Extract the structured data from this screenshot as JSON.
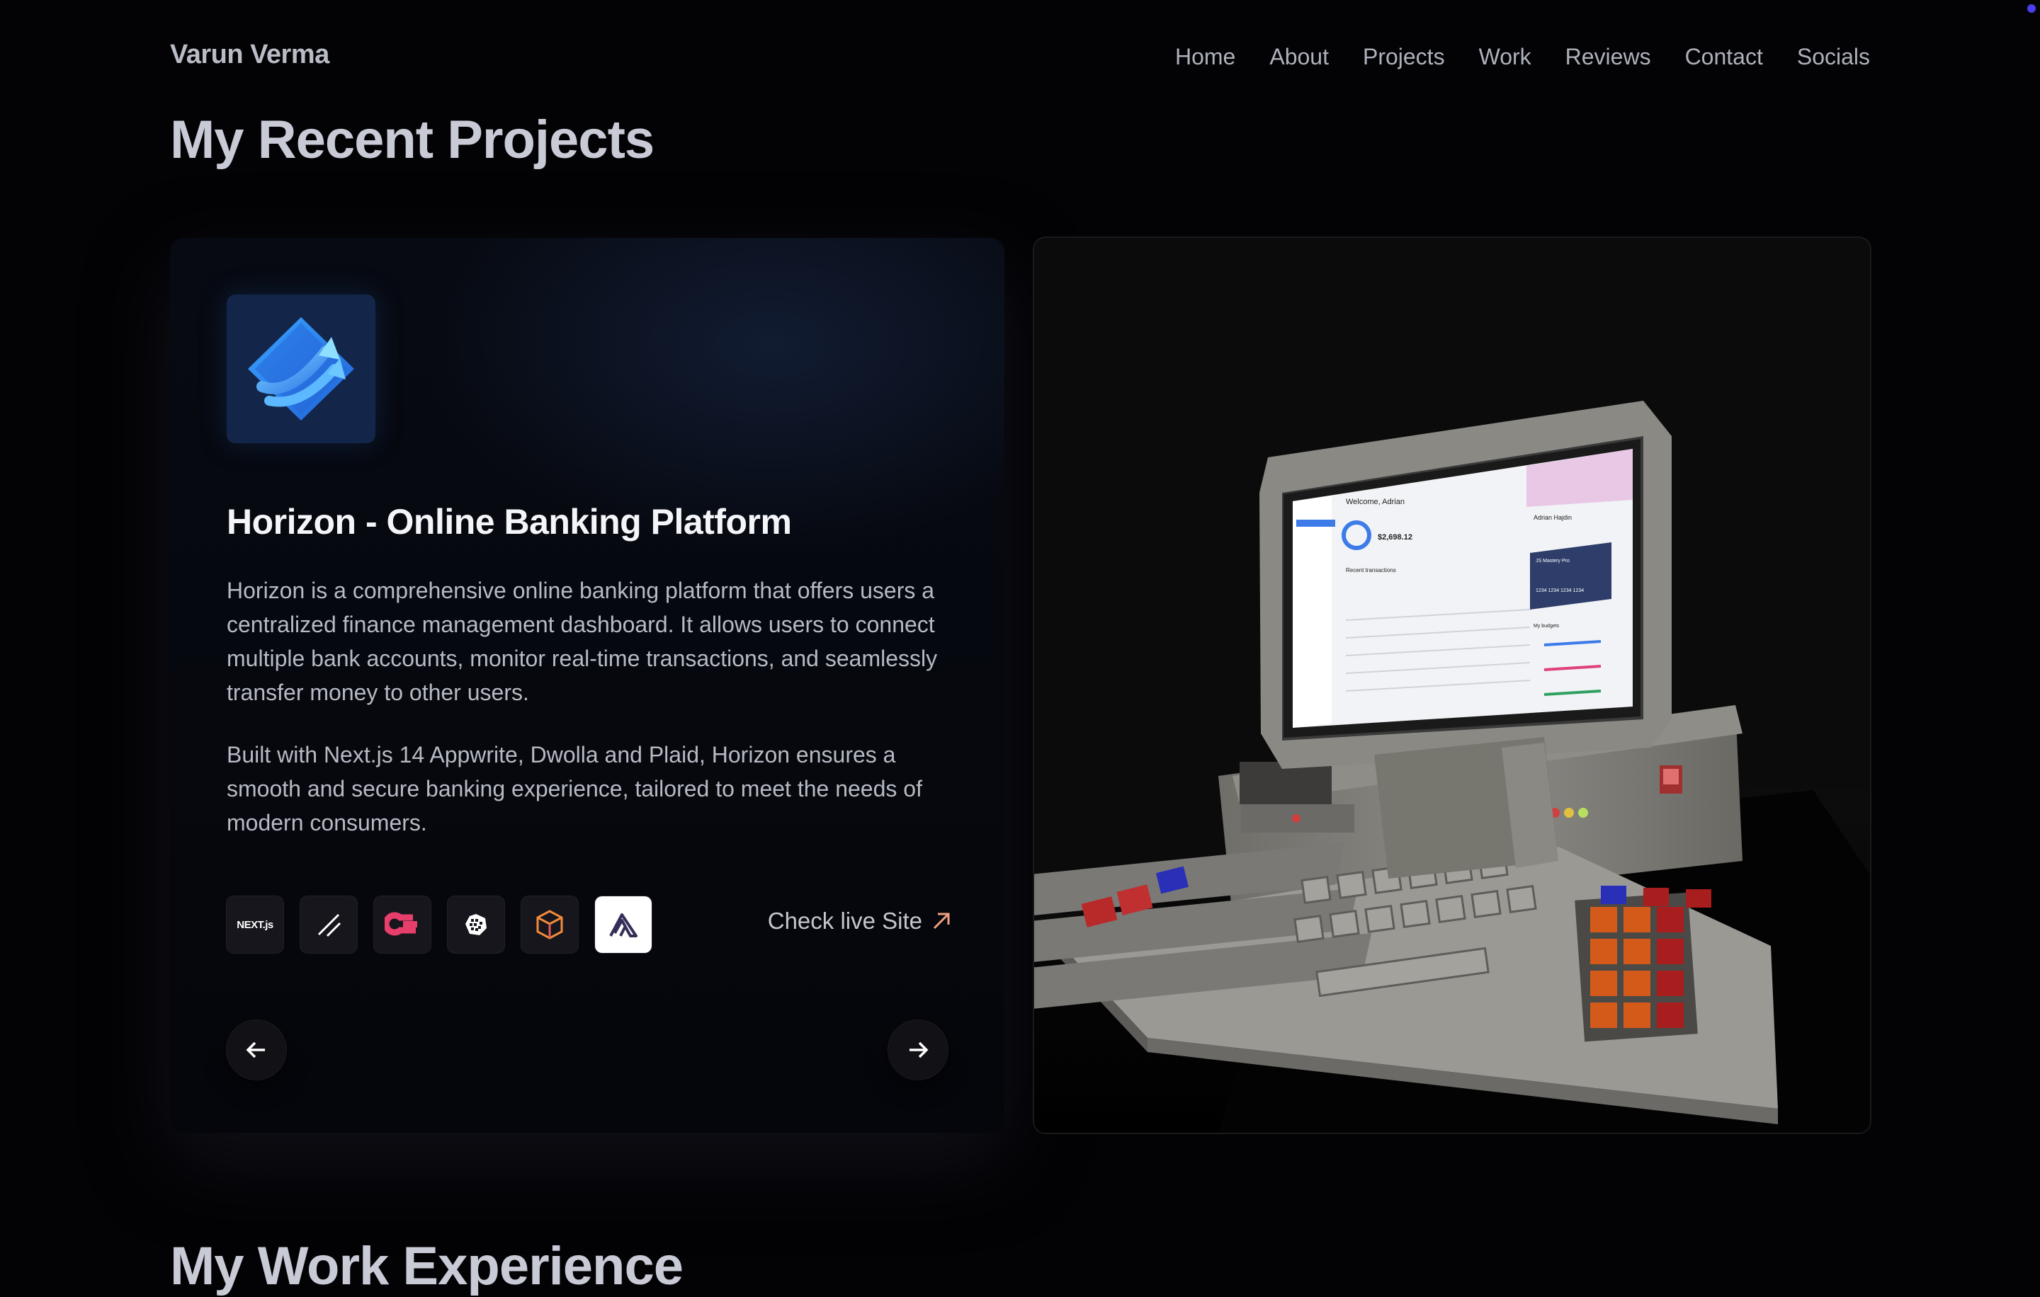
{
  "brand": "Varun Verma",
  "nav": [
    "Home",
    "About",
    "Projects",
    "Work",
    "Reviews",
    "Contact",
    "Socials"
  ],
  "section_title": "My Recent Projects",
  "next_section_title": "My Work Experience",
  "project": {
    "title": "Horizon - Online Banking Platform",
    "description_1": "Horizon is a comprehensive online banking platform that offers users a centralized finance management dashboard. It allows users to connect multiple bank accounts, monitor real-time transactions, and seamlessly transfer money to other users.",
    "description_2": "Built with Next.js 14 Appwrite, Dwolla and Plaid, Horizon ensures a smooth and secure banking experience, tailored to meet the needs of modern consumers.",
    "tech_icons": [
      "nextjs-icon",
      "shadcn-icon",
      "appwrite-icon",
      "plaid-icon",
      "dwolla-icon",
      "sentry-icon"
    ],
    "nextjs_label": "NEXT.js",
    "live_link": "Check live Site",
    "screen": {
      "welcome": "Welcome, Adrian",
      "balance": "$2,698.12",
      "recent": "Recent transactions",
      "user": "Adrian Hajdin",
      "card_brand": "JS Mastery Pro",
      "card_number": "1234 1234 1234 1234",
      "budgets": "My budgets"
    }
  },
  "colors": {
    "accent_dot": "#4b3df0",
    "logo_bg": "#13264a",
    "appwrite": "#e83e6c",
    "dwolla": "#f28a3c"
  }
}
